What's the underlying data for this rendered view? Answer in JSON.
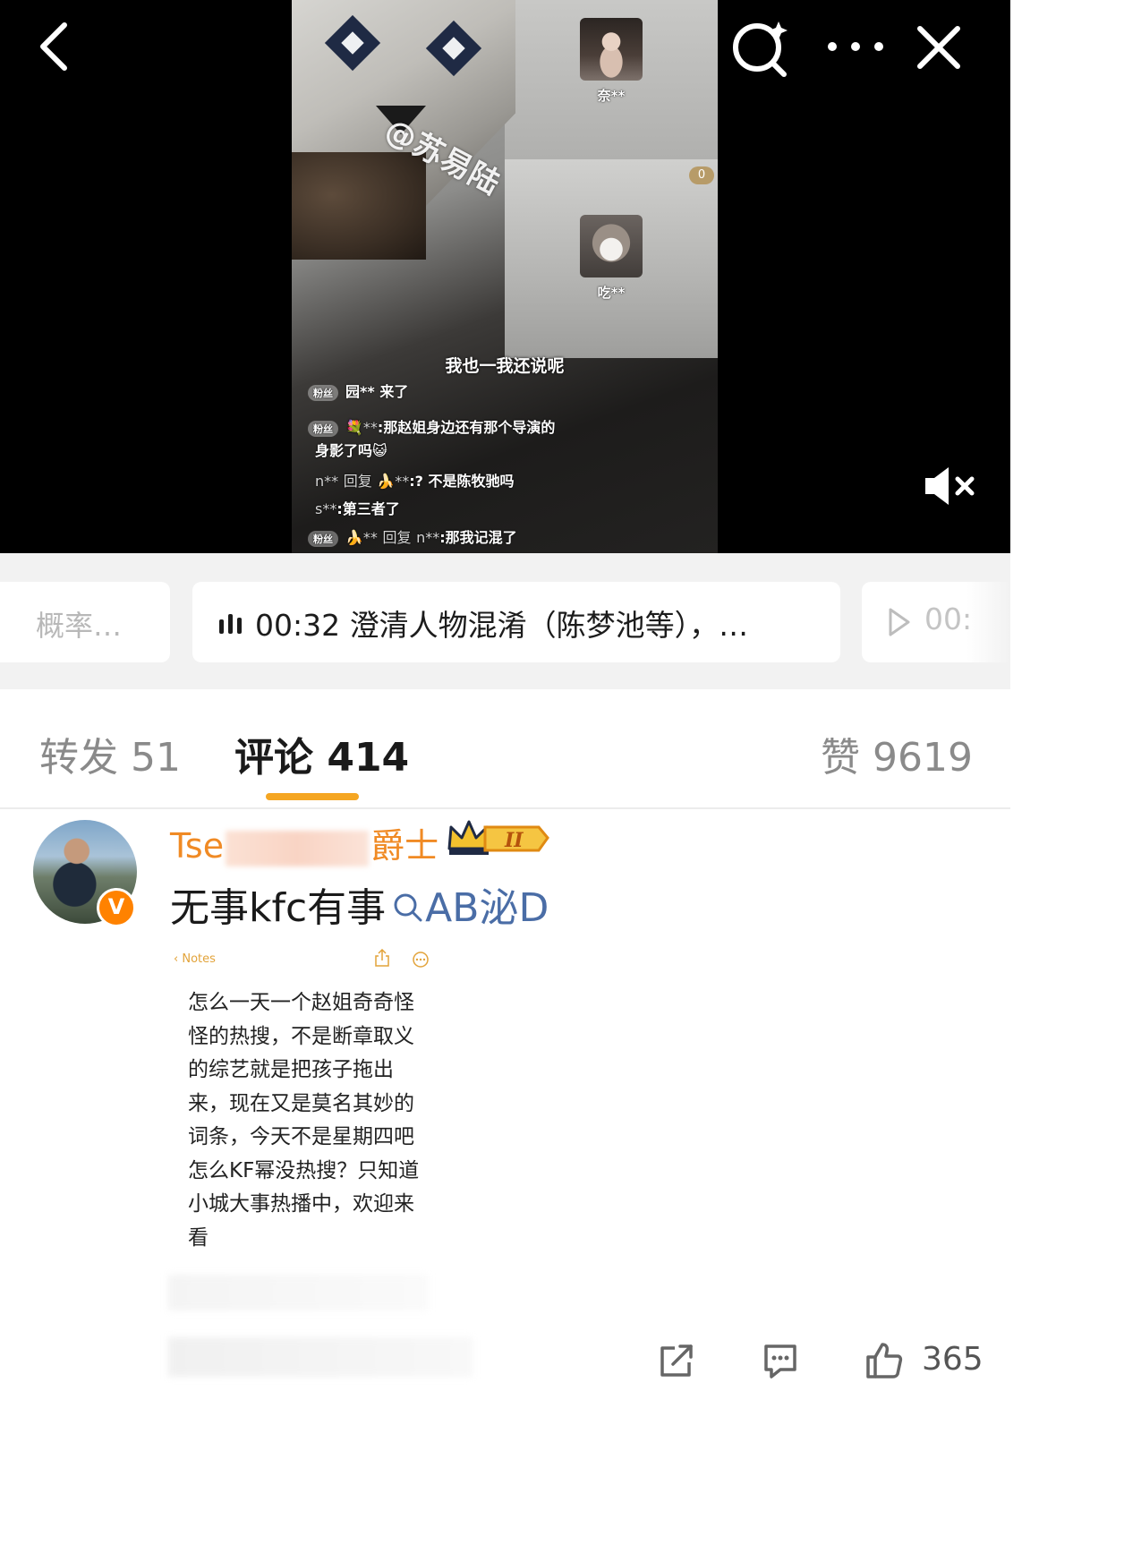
{
  "video": {
    "watermark": "@苏易陆",
    "participants": [
      {
        "name": "奈**"
      },
      {
        "name": "吃**"
      }
    ],
    "gift_count": "0",
    "subtitle": "我也一我还说呢",
    "fan_tag": "粉丝",
    "chat": {
      "line1_name": "园**",
      "line1_text": "来了",
      "line2_name": "💐**",
      "line2_text": ":那赵姐身边还有那个导演的",
      "line2_cont": "身影了吗😺",
      "line3_name": "n**",
      "line3_reply": "回复",
      "line3_target": "🍌**",
      "line3_text": ":? 不是陈牧驰吗",
      "line4_name": "s**",
      "line4_text": ":第三者了",
      "line5_name": "🍌**",
      "line5_reply": "回复",
      "line5_target": "n**",
      "line5_text": ":那我记混了"
    },
    "icons": [
      "back-icon",
      "ai-search-icon",
      "more-icon",
      "close-icon",
      "mute-icon"
    ]
  },
  "chapters": {
    "prev_text": "概率…",
    "current_time": "00:32",
    "current_text": "澄清人物混淆（陈梦池等），…",
    "next_time": "00:"
  },
  "tabs": {
    "repost_label": "转发",
    "repost_count": "51",
    "comment_label": "评论",
    "comment_count": "414",
    "likes_label": "赞",
    "likes_count": "9619",
    "active": "comment",
    "accent_color": "#f5a623"
  },
  "comment": {
    "username_start": "Tse",
    "username_end": "爵士",
    "level_badge": "II",
    "verified_badge": "V",
    "text": "无事kfc有事",
    "search_tag": "AB泌D",
    "like_count": "365",
    "image": {
      "notes_back": "Notes",
      "body": "怎么一天一个赵姐奇奇怪怪的热搜，不是断章取义的综艺就是把孩子拖出来，现在又是莫名其妙的词条，今天不是星期四吧怎么KF幂没热搜？只知道小城大事热播中，欢迎来看"
    }
  }
}
